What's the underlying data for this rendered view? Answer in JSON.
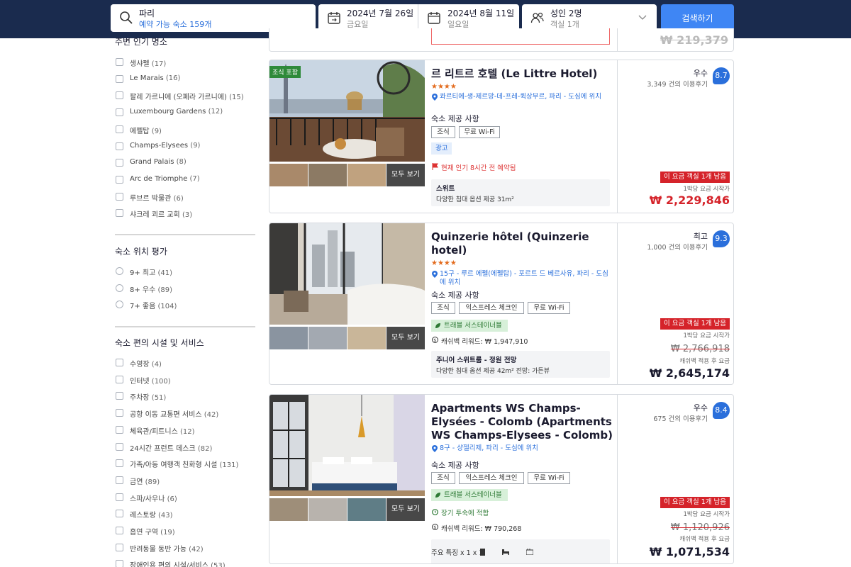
{
  "search": {
    "destination": "파리",
    "available": "예약 가능 숙소 159개",
    "checkin_date": "2024년 7월 26일",
    "checkin_day": "금요일",
    "checkout_date": "2024년 8월 11일",
    "checkout_day": "일요일",
    "guests": "성인 2명",
    "rooms": "객실 1개",
    "button": "검색하기"
  },
  "sidebar": {
    "landmarks_title": "주변 인기 명소",
    "landmarks": [
      {
        "label": "생샤펠",
        "count": "(17)"
      },
      {
        "label": "Le Marais",
        "count": "(16)"
      },
      {
        "label": "팔레 가르니에 (오페라 가르니에)",
        "count": "(15)"
      },
      {
        "label": "Luxembourg Gardens",
        "count": "(12)"
      },
      {
        "label": "에펠탑",
        "count": "(9)"
      },
      {
        "label": "Champs-Elysees",
        "count": "(9)"
      },
      {
        "label": "Grand Palais",
        "count": "(8)"
      },
      {
        "label": "Arc de Triomphe",
        "count": "(7)"
      },
      {
        "label": "루브르 박물관",
        "count": "(6)"
      },
      {
        "label": "샤크레 쾨르 교회",
        "count": "(3)"
      }
    ],
    "location_title": "숙소 위치 평가",
    "location": [
      {
        "label": "9+  최고",
        "count": "(41)"
      },
      {
        "label": "8+  우수",
        "count": "(89)"
      },
      {
        "label": "7+  좋음",
        "count": "(104)"
      }
    ],
    "facilities_title": "숙소 편의 시설 및 서비스",
    "facilities": [
      {
        "label": "수영장",
        "count": "(4)"
      },
      {
        "label": "인터넷",
        "count": "(100)"
      },
      {
        "label": "주차장",
        "count": "(51)"
      },
      {
        "label": "공항 이동 교통편 서비스",
        "count": "(42)"
      },
      {
        "label": "체육관/피트니스",
        "count": "(12)"
      },
      {
        "label": "24시간 프런트 데스크",
        "count": "(82)"
      },
      {
        "label": "가족/아동 여행객 친화형 시설",
        "count": "(131)"
      },
      {
        "label": "금연",
        "count": "(89)"
      },
      {
        "label": "스파/사우나",
        "count": "(6)"
      },
      {
        "label": "레스토랑",
        "count": "(43)"
      },
      {
        "label": "흡연 구역",
        "count": "(19)"
      },
      {
        "label": "반려동물 동반 가능",
        "count": "(42)"
      },
      {
        "label": "장애인용 편의 시설/서비스",
        "count": "(53)"
      }
    ]
  },
  "partial_card": {
    "price": "₩ 219,379"
  },
  "hotels": [
    {
      "name": "르 리트르 호텔 (Le Littre Hotel)",
      "stars": "★★★★",
      "breakfast_badge": "조식 포함",
      "location": "콰르티에-생-제르망-데-프레-퀵상부르, 파리 - 도심에 위치",
      "amen_label": "숙소 제공 사항",
      "chips": [
        "조식",
        "무료 Wi-Fi"
      ],
      "ad": "광고",
      "popular": "현재 인기 8시간 전 예약됨",
      "room_type": "스위트",
      "room_detail": "다양한 침대 옵션 제공   31m²",
      "all_photos": "모두 보기",
      "rating_label": "우수",
      "reviews": "3,349 건의 이용후기",
      "score": "8.7",
      "left_badge": "이 요금 객실 1개 남음",
      "per_night": "1박당 요금 시작가",
      "price": "₩ 2,229,846"
    },
    {
      "name": "Quinzerie hôtel (Quinzerie hotel)",
      "stars": "★★★★",
      "location": "15구 - 루르 에펠(에펠탑) - 포르트 드 베르사유, 파리 - 도심에 위치",
      "amen_label": "숙소 제공 사항",
      "chips": [
        "조식",
        "익스프레스 체크인",
        "무료 Wi-Fi"
      ],
      "green": "트래블 서스테이너블",
      "cashback": "캐쉬백 리워드: ₩ 1,947,910",
      "room_type": "주니어 스위트룸 - 정원 전망",
      "room_detail": "다양한 침대 옵션 제공   42m²   전망: 가든뷰",
      "all_photos": "모두 보기",
      "rating_label": "최고",
      "reviews": "1,000 건의 이용후기",
      "score": "9.3",
      "left_badge": "이 요금 객실 1개 남음",
      "per_night": "1박당 요금 시작가",
      "old_price": "₩ 2,766,918",
      "cb_note": "캐쉬백 적용 후 요금",
      "price": "₩ 2,645,174"
    },
    {
      "name": "Apartments WS Champs-Elysées - Colomb (Apartments WS Champs-Elysees - Colomb)",
      "location": "8구 - 샹젤리제, 파리 - 도심에 위치",
      "amen_label": "숙소 제공 사항",
      "chips": [
        "조식",
        "익스프레스 체크인",
        "무료 Wi-Fi"
      ],
      "green": "트래블 서스테이너블",
      "longstay": "장기 투숙에 적합",
      "cashback": "캐쉬백 리워드: ₩ 790,268",
      "features": "주요 특징      x 1      x 1",
      "all_photos": "모두 보기",
      "rating_label": "우수",
      "reviews": "675 건의 이용후기",
      "score": "8.4",
      "left_badge": "이 요금 객실 1개 남음",
      "per_night": "1박당 요금 시작가",
      "old_price": "₩ 1,120,926",
      "cb_note": "캐쉬백 적용 후 요금",
      "price": "₩ 1,071,534"
    }
  ],
  "colors": {
    "header": "#1a2b4e",
    "accent": "#3f86f4",
    "score": "#2a6fdb",
    "urgent": "#d5232a",
    "stars": "#e36b1d",
    "green_badge": "#d7f0d9"
  }
}
